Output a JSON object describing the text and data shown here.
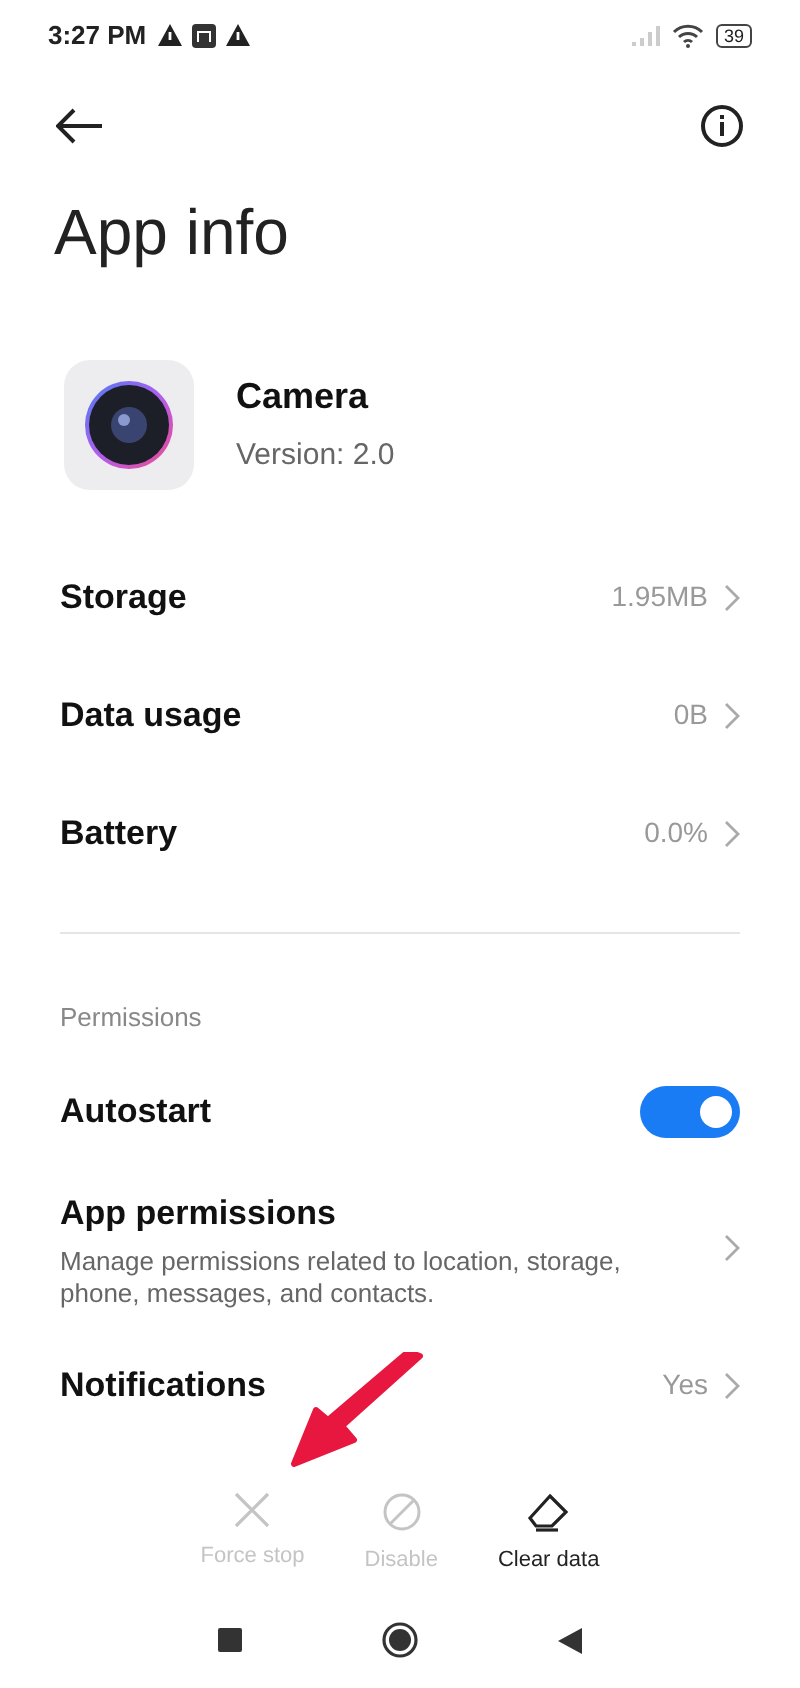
{
  "status_bar": {
    "time": "3:27 PM",
    "battery": "39"
  },
  "title": "App info",
  "app": {
    "name": "Camera",
    "version": "Version: 2.0"
  },
  "rows": [
    {
      "label": "Storage",
      "value": "1.95MB"
    },
    {
      "label": "Data usage",
      "value": "0B"
    },
    {
      "label": "Battery",
      "value": "0.0%"
    }
  ],
  "section": "Permissions",
  "autostart": {
    "label": "Autostart",
    "on": true
  },
  "permission_rows": [
    {
      "label": "App permissions",
      "description": "Manage permissions related to location, storage, phone, messages, and contacts."
    },
    {
      "label": "Notifications",
      "value": "Yes"
    }
  ],
  "actions": [
    {
      "kind": "stop",
      "label": "Force stop",
      "disabled": true
    },
    {
      "kind": "disable",
      "label": "Disable",
      "disabled": true
    },
    {
      "kind": "clear",
      "label": "Clear data",
      "disabled": false
    }
  ]
}
